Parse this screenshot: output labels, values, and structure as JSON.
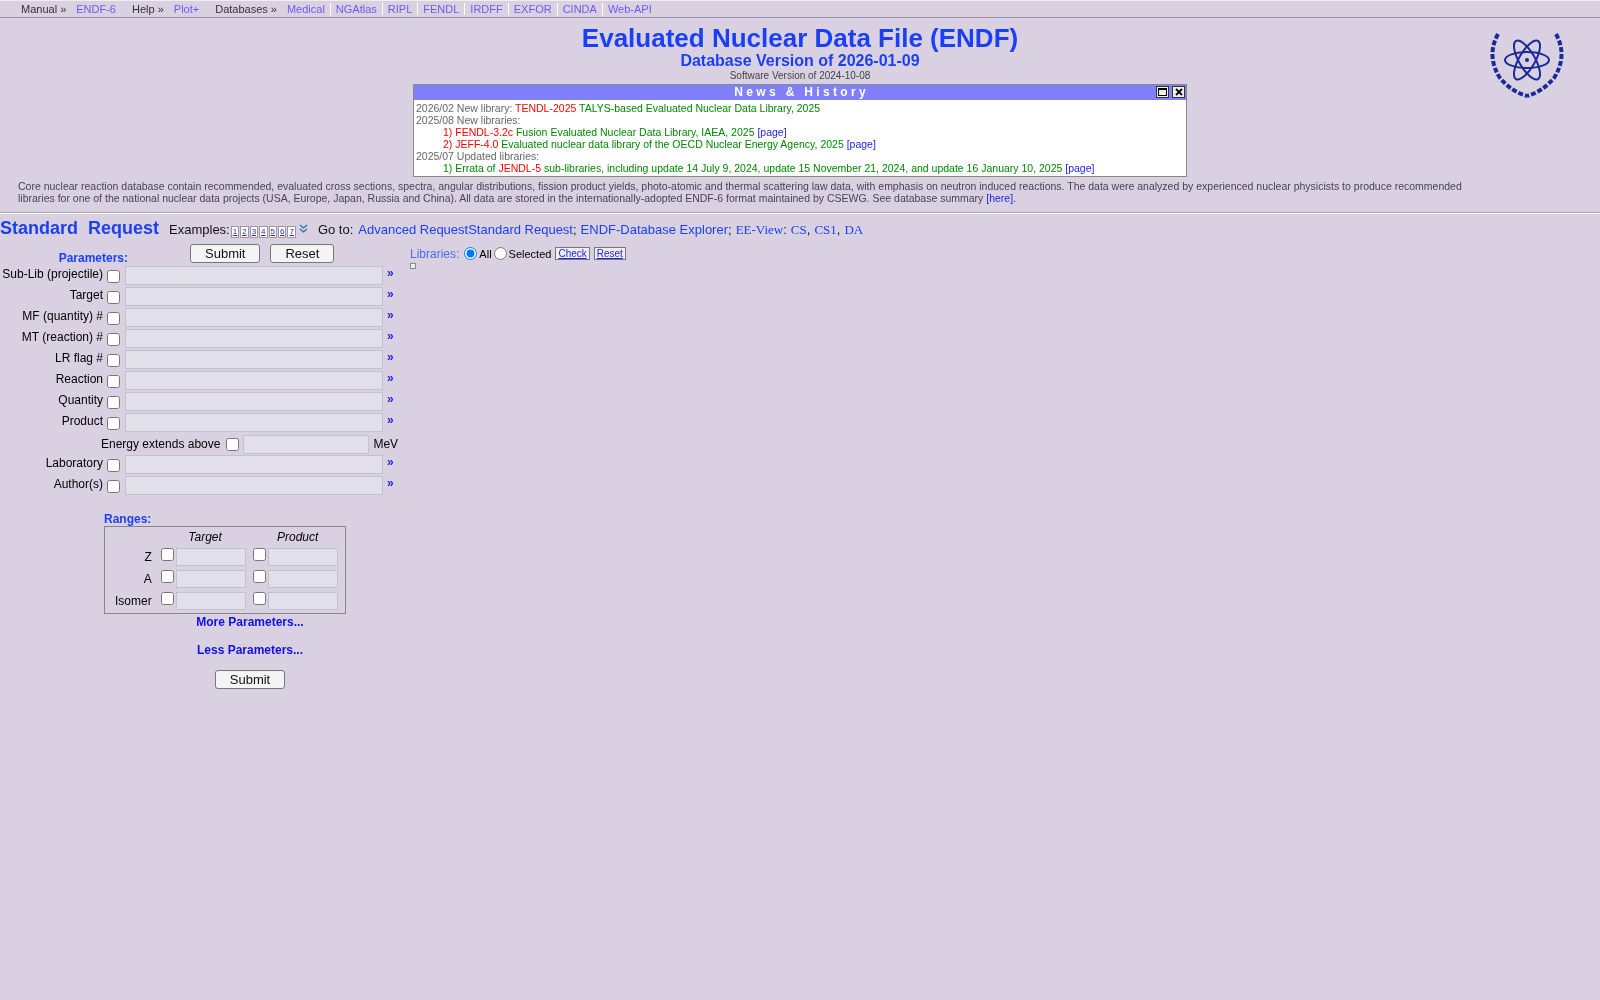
{
  "top_nav": [
    {
      "text": "Manual »",
      "kind": "label"
    },
    {
      "text": "ENDF-6",
      "kind": "link"
    },
    {
      "text": "Help »",
      "kind": "label"
    },
    {
      "text": "Plot+",
      "kind": "link"
    },
    {
      "text": "Databases »",
      "kind": "label"
    },
    {
      "text": "Medical",
      "kind": "link"
    },
    {
      "text": "NGAtlas",
      "kind": "link"
    },
    {
      "text": "RIPL",
      "kind": "link"
    },
    {
      "text": "FENDL",
      "kind": "link"
    },
    {
      "text": "IRDFF",
      "kind": "link"
    },
    {
      "text": "EXFOR",
      "kind": "link"
    },
    {
      "text": "CINDA",
      "kind": "link"
    },
    {
      "text": "Web-API",
      "kind": "link"
    }
  ],
  "header": {
    "title": "Evaluated Nuclear Data File (ENDF)",
    "db_version": "Database Version of 2026-01-09",
    "sw_version": "Software Version of 2024-10-08"
  },
  "news": {
    "title": "N e w s   &   H i s t o r y",
    "lines": [
      {
        "parts": [
          {
            "kind": "date",
            "text": "2026/02 New library: "
          },
          {
            "kind": "name",
            "text": "TENDL-2025"
          },
          {
            "kind": "desc",
            "text": " TALYS-based Evaluated Nuclear Data Library, 2025"
          }
        ]
      },
      {
        "parts": [
          {
            "kind": "date",
            "text": "2025/08 New libraries:"
          }
        ],
        "children": [
          {
            "parts": [
              {
                "kind": "name",
                "text": "1) FENDL-3.2c"
              },
              {
                "kind": "desc",
                "text": " Fusion Evaluated Nuclear Data Library, IAEA, 2025 "
              },
              {
                "kind": "link",
                "text": "[page]"
              }
            ]
          },
          {
            "parts": [
              {
                "kind": "name",
                "text": "2) JEFF-4.0"
              },
              {
                "kind": "desc",
                "text": " Evaluated nuclear data library of the OECD Nuclear Energy Agency, 2025 "
              },
              {
                "kind": "link",
                "text": "[page]"
              }
            ]
          }
        ]
      },
      {
        "parts": [
          {
            "kind": "date",
            "text": "2025/07 Updated libraries:"
          }
        ],
        "children": [
          {
            "parts": [
              {
                "kind": "desc",
                "text": "1) Errata of "
              },
              {
                "kind": "name",
                "text": "JENDL-5"
              },
              {
                "kind": "desc",
                "text": " sub-libraries, including update 14 July 9, 2024, update 15 November 21, 2024, and update 16 January 10, 2025 "
              },
              {
                "kind": "link",
                "text": "[page]"
              }
            ]
          }
        ]
      }
    ]
  },
  "description": {
    "text": "Core nuclear reaction database contain recommended, evaluated cross sections, spectra, angular distributions, fission product yields, photo-atomic and thermal scattering law data, with emphasis on neutron induced reactions. The data were analyzed by experienced nuclear physicists to produce recommended libraries for one of the national nuclear data projects (USA, Europe, Japan, Russia and China). All data are stored in the internationally-adopted ENDF-6 format maintained by CSEWG. See database summary ",
    "link": "[here]",
    "end": "."
  },
  "request_bar": {
    "title_words": [
      "Standard",
      "Request"
    ],
    "examples_label": "Examples:",
    "examples": [
      "1",
      "2",
      "3",
      "4",
      "5",
      "6",
      "7"
    ],
    "goto_label": "Go to:",
    "links": [
      {
        "text": "Advanced Request",
        "kind": "sans"
      },
      {
        "text": "Standard Request",
        "kind": "sans"
      },
      {
        "text": ";",
        "kind": "punct"
      },
      {
        "text": "ENDF-Database Explorer",
        "kind": "sans"
      },
      {
        "text": ";",
        "kind": "punct"
      },
      {
        "text": "EE-View",
        "kind": "serif"
      },
      {
        "text": ":",
        "kind": "punct"
      },
      {
        "text": "CS",
        "kind": "serif"
      },
      {
        "text": ",",
        "kind": "punct"
      },
      {
        "text": "CS1",
        "kind": "serif"
      },
      {
        "text": ",",
        "kind": "punct"
      },
      {
        "text": "DA",
        "kind": "serif"
      }
    ]
  },
  "form": {
    "parameters_label": "Parameters:",
    "buttons": [
      "Submit",
      "Reset"
    ],
    "fields": [
      {
        "label": "Sub-Lib (projectile)",
        "checked": false
      },
      {
        "label": "Target",
        "checked": false
      },
      {
        "label": "MF (quantity) #",
        "checked": false
      },
      {
        "label": "MT (reaction) #",
        "checked": false
      },
      {
        "label": "LR flag #",
        "checked": false
      },
      {
        "label": "Reaction",
        "checked": false
      },
      {
        "label": "Quantity",
        "checked": false
      },
      {
        "label": "Product",
        "checked": false
      }
    ],
    "more_symbol": "»",
    "energy": {
      "label": "Energy extends above",
      "checked": false,
      "unit": "MeV"
    },
    "fields2": [
      {
        "label": "Laboratory",
        "checked": false
      },
      {
        "label": "Author(s)",
        "checked": false
      }
    ],
    "ranges": {
      "label": "Ranges:",
      "columns": [
        "Target",
        "Product"
      ],
      "rows": [
        {
          "label": "Z",
          "target_checked": false,
          "product_checked": false
        },
        {
          "label": "A",
          "target_checked": false,
          "product_checked": false
        },
        {
          "label": "Isomer",
          "target_checked": false,
          "product_checked": false
        }
      ]
    },
    "more_link": "More Parameters...",
    "less_link": "Less Parameters...",
    "bottom_button": "Submit"
  },
  "libraries": {
    "label": "Libraries:",
    "options": [
      {
        "label": "All",
        "selected": true
      },
      {
        "label": "Selected",
        "selected": false
      }
    ],
    "buttons": [
      "Check",
      "Reset"
    ]
  }
}
